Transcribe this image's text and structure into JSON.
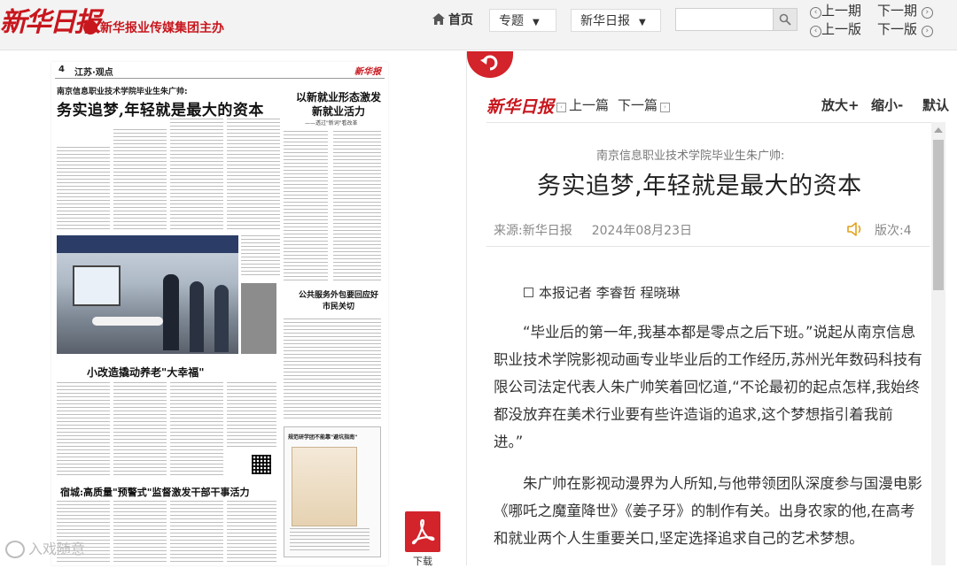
{
  "header": {
    "logo_text": "新华日报",
    "logo_sub": "新华报业传媒集团主办",
    "home_label": "首页",
    "topic_dropdown": "专题",
    "paper_dropdown": "新华日报",
    "search_placeholder": "",
    "prev_issue": "上一期",
    "next_issue": "下一期",
    "prev_page": "上一版",
    "next_page": "下一版"
  },
  "newspaper_page": {
    "page_number": "4",
    "section": "江苏·观点",
    "brand": "新华报",
    "kicker": "南京信息职业技术学院毕业生朱广帅:",
    "headline": "务实追梦,年轻就是最大的资本",
    "side_title": "以新就业形态激发新就业活力",
    "side_sub": "——透过\"新词\"看改革",
    "story2_title": "小改造撬动养老\"大幸福\"",
    "story3_title": "公共服务外包要回应好市民关切",
    "story4_title": "宿城:高质量\"预警式\"监督激发干部干事活力",
    "box_title": "规范研学团不能靠\"避坑指南\""
  },
  "pdf": {
    "label": "下载"
  },
  "watermark": {
    "text": "入戏随意"
  },
  "article": {
    "logo": "新华日报",
    "prev_article": "上一篇",
    "next_article": "下一篇",
    "zoom_in": "放大+",
    "zoom_out": "缩小-",
    "zoom_reset": "默认",
    "kicker": "南京信息职业技术学院毕业生朱广帅:",
    "title": "务实追梦,年轻就是最大的资本",
    "source": "来源:新华日报",
    "date": "2024年08月23日",
    "page_label": "版次:4",
    "author": "本报记者 李睿哲 程晓琳",
    "paragraphs": [
      "“毕业后的第一年,我基本都是零点之后下班。”说起从南京信息职业技术学院影视动画专业毕业后的工作经历,苏州光年数码科技有限公司法定代表人朱广帅笑着回忆道,“不论最初的起点怎样,我始终都没放弃在美术行业要有些许造诣的追求,这个梦想指引着我前进。”",
      "朱广帅在影视动漫界为人所知,与他带领团队深度参与国漫电影《哪吒之魔童降世》《姜子牙》的制作有关。出身农家的他,在高考和就业两个人生重要关口,坚定选择追求自己的艺术梦想。"
    ]
  }
}
